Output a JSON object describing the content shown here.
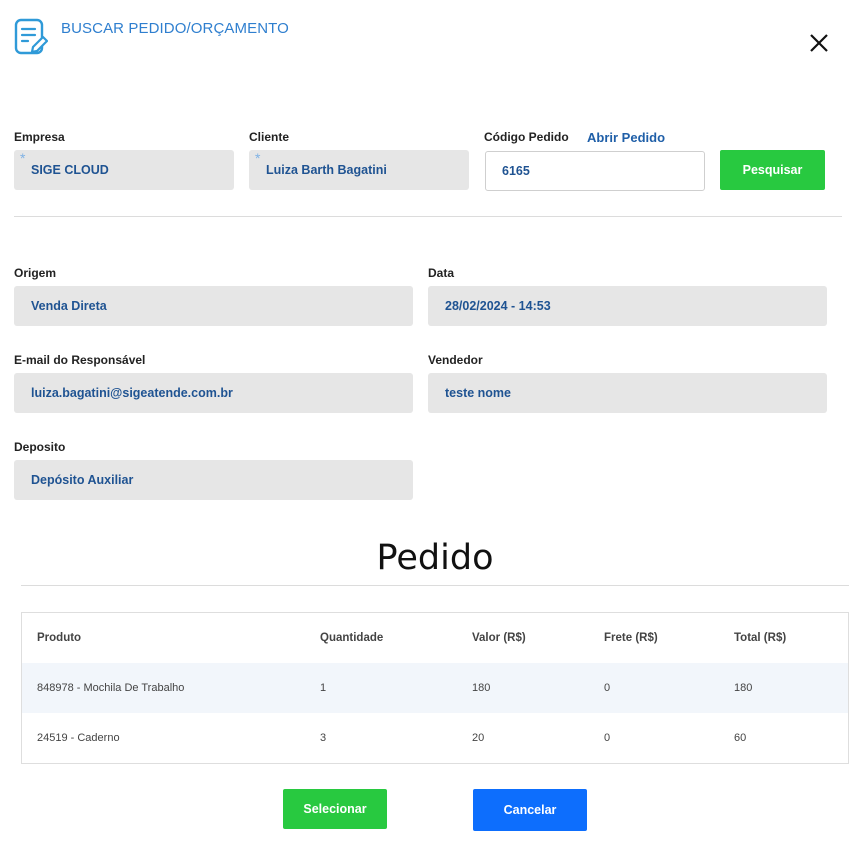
{
  "header": {
    "title": "BUSCAR PEDIDO/ORÇAMENTO",
    "icon": "document-edit-icon",
    "close_icon": "close-icon"
  },
  "search": {
    "empresa_label": "Empresa",
    "empresa_value": "SIGE CLOUD",
    "cliente_label": "Cliente",
    "cliente_value": "Luiza Barth Bagatini",
    "required_mark": "*",
    "codigo_label": "Código Pedido",
    "abrir_link": "Abrir Pedido",
    "codigo_value": "6165",
    "search_button": "Pesquisar"
  },
  "details": {
    "origem_label": "Origem",
    "origem_value": "Venda Direta",
    "data_label": "Data",
    "data_value": "28/02/2024 - 14:53",
    "email_label": "E-mail do Responsável",
    "email_value": "luiza.bagatini@sigeatende.com.br",
    "vendedor_label": "Vendedor",
    "vendedor_value": "teste nome",
    "deposito_label": "Deposito",
    "deposito_value": "Depósito Auxiliar"
  },
  "order": {
    "title": "Pedido",
    "columns": [
      "Produto",
      "Quantidade",
      "Valor (R$)",
      "Frete (R$)",
      "Total (R$)"
    ],
    "rows": [
      [
        "848978 - Mochila De Trabalho",
        "1",
        "180",
        "0",
        "180"
      ],
      [
        "24519 - Caderno",
        "3",
        "20",
        "0",
        "60"
      ]
    ]
  },
  "footer": {
    "select_button": "Selecionar",
    "cancel_button": "Cancelar"
  },
  "colors": {
    "accent_blue": "#2f7fcf",
    "value_text": "#1f5392",
    "green_button": "#28c940",
    "blue_button": "#0d6efd",
    "field_bg": "#e6e6e6"
  }
}
